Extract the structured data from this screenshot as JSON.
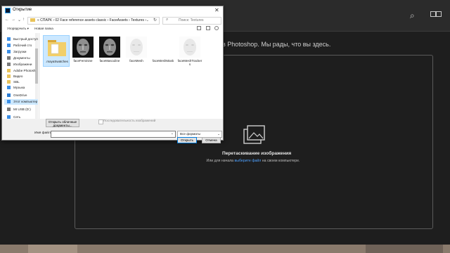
{
  "photoshop": {
    "welcome_text": "в Photoshop. Мы рады, что вы здесь.",
    "drop_title": "Перетаскивание изображения",
    "drop_sub_before": "Или для начала",
    "drop_sub_link": "выберите файл",
    "drop_sub_after": "на своем компьютере."
  },
  "dialog": {
    "title": "Открытие",
    "close": "✕",
    "path": "« СПАРК › 02 Face reference assets classic › FaceAssets › Textures ›",
    "search_placeholder": "Поиск: Textures",
    "organize": "Упорядочить ▾",
    "new_folder": "Новая папка",
    "nav_items": [
      {
        "label": "Быстрый доступ",
        "icon": "star-icon",
        "color": "#3a8ee6"
      },
      {
        "label": "Рабочий сто",
        "icon": "desktop-icon",
        "color": "#3a8ee6"
      },
      {
        "label": "Загрузки",
        "icon": "download-icon",
        "color": "#3a8ee6"
      },
      {
        "label": "Документы",
        "icon": "documents-icon",
        "color": "#7a7a7a"
      },
      {
        "label": "Изображени",
        "icon": "pictures-icon",
        "color": "#7a7a7a"
      },
      {
        "label": "Adobe Photosh",
        "icon": "folder-icon",
        "color": "#e9c35a"
      },
      {
        "label": "Видео",
        "icon": "folder-icon",
        "color": "#e9c35a"
      },
      {
        "label": "SBL",
        "icon": "folder-icon",
        "color": "#e9c35a"
      },
      {
        "label": "Музыка",
        "icon": "music-icon",
        "color": "#3a8ee6"
      },
      {
        "label": "OneDrive",
        "icon": "cloud-icon",
        "color": "#2b7cd3"
      },
      {
        "label": "Этот компьютер",
        "icon": "computer-icon",
        "color": "#3a8ee6"
      },
      {
        "label": "MI USB (D:)",
        "icon": "drive-icon",
        "color": "#7a7a7a"
      },
      {
        "label": "Сеть",
        "icon": "network-icon",
        "color": "#3a8ee6"
      }
    ],
    "files": [
      {
        "name": ".mayaSwatches",
        "kind": "folder"
      },
      {
        "name": "faceFeminine",
        "kind": "face-dark"
      },
      {
        "name": "faceMasculine",
        "kind": "face-dark"
      },
      {
        "name": "faceMesh",
        "kind": "face-light"
      },
      {
        "name": "faceMeshMask",
        "kind": "blank"
      },
      {
        "name": "faceMeshTracker s",
        "kind": "face-light"
      }
    ],
    "cloud_btn": "Открыть облачные документы...",
    "preview_label": "Последовательность изображений",
    "filename_label": "Имя файла:",
    "filename_value": "",
    "filetype": "Все форматы",
    "open_btn": "Открыть",
    "cancel_btn": "Отмена"
  }
}
